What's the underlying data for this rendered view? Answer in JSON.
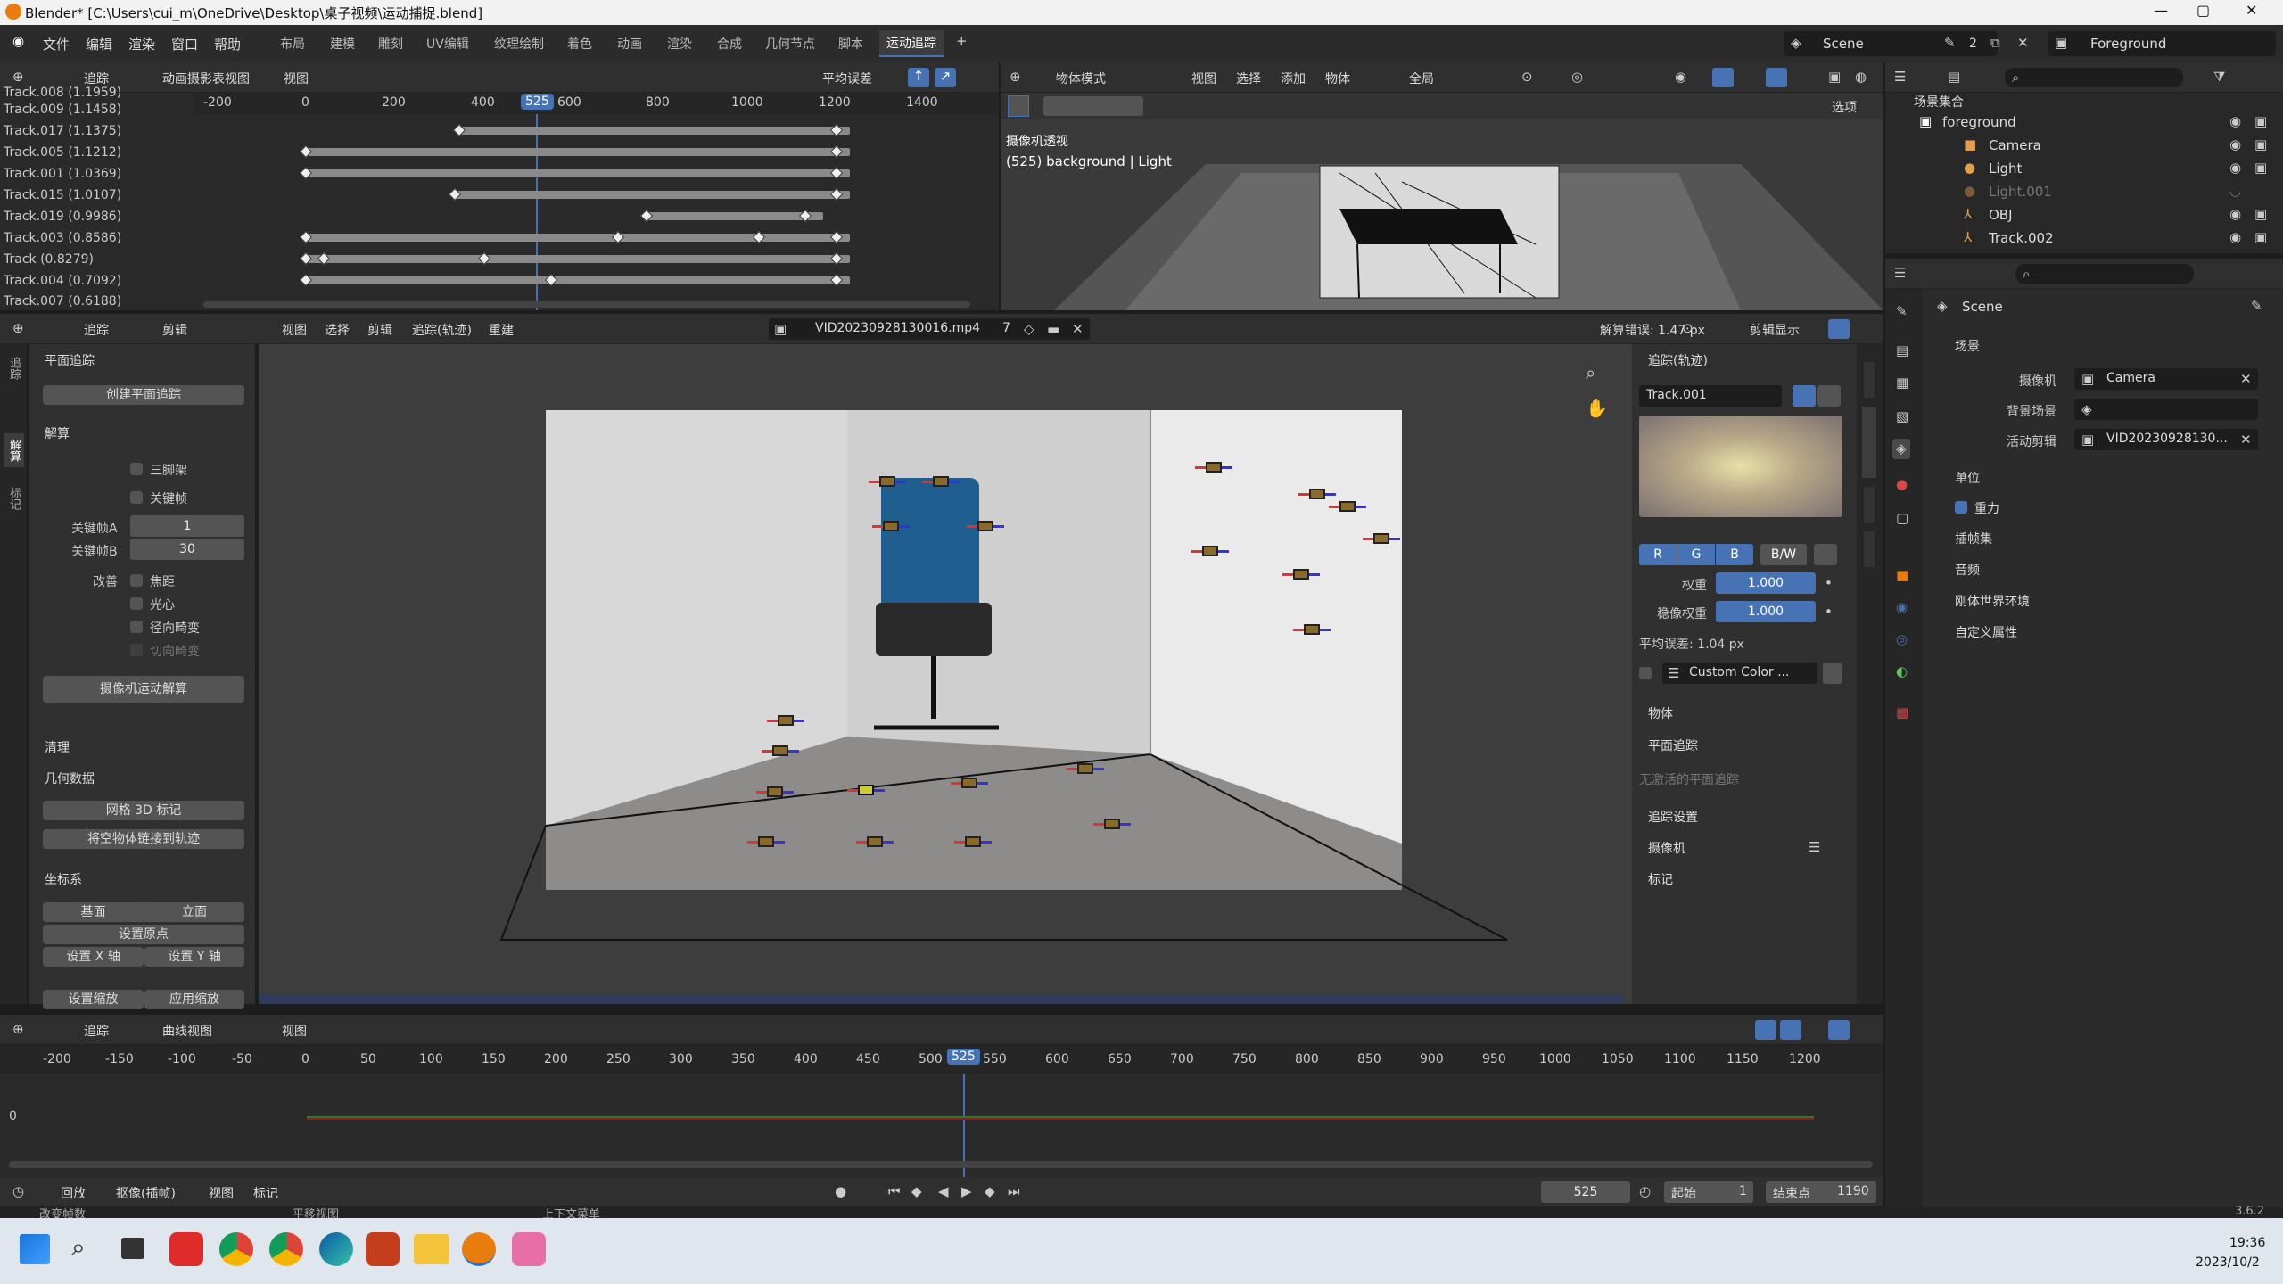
{
  "window": {
    "title": "Blender* [C:\\Users\\cui_m\\OneDrive\\Desktop\\桌子视频\\运动捕捉.blend]"
  },
  "menu": {
    "file": "文件",
    "edit": "编辑",
    "render": "渲染",
    "window": "窗口",
    "help": "帮助"
  },
  "workspaces": [
    "布局",
    "建模",
    "雕刻",
    "UV编辑",
    "纹理绘制",
    "着色",
    "动画",
    "渲染",
    "合成",
    "几何节点",
    "脚本",
    "运动追踪"
  ],
  "topright": {
    "scene": "Scene",
    "scene_count": "2",
    "view_layer": "Foreground"
  },
  "dopesheet": {
    "mode": "追踪",
    "view_mode": "动画摄影表视图",
    "menu_view": "视图",
    "sort": "平均误差",
    "ruler": [
      "-200",
      "0",
      "200",
      "400",
      "600",
      "800",
      "1000",
      "1200",
      "1400"
    ],
    "current_frame": "525",
    "tracks": [
      "Track.008 (1.1959)",
      "Track.009 (1.1458)",
      "Track.017 (1.1375)",
      "Track.005 (1.1212)",
      "Track.001 (1.0369)",
      "Track.015 (1.0107)",
      "Track.019 (0.9986)",
      "Track.003 (0.8586)",
      "Track (0.8279)",
      "Track.004 (0.7092)",
      "Track.007 (0.6188)"
    ]
  },
  "viewport3d": {
    "mode": "物体模式",
    "menus": [
      "视图",
      "选择",
      "添加",
      "物体"
    ],
    "transform": "全局",
    "options": "选项",
    "overlay_title": "摄像机透视",
    "overlay_sub": "(525) background | Light"
  },
  "outliner": {
    "root": "场景集合",
    "items": [
      {
        "name": "foreground"
      },
      {
        "name": "Camera"
      },
      {
        "name": "Light"
      },
      {
        "name": "Light.001"
      },
      {
        "name": "OBJ"
      },
      {
        "name": "Track.002"
      }
    ]
  },
  "properties": {
    "scene": "Scene",
    "section": "场景",
    "camera_label": "摄像机",
    "camera_value": "Camera",
    "bg_label": "背景场景",
    "clip_label": "活动剪辑",
    "clip_value": "VID20230928130...",
    "panels": [
      "单位",
      "重力",
      "插帧集",
      "音频",
      "刚体世界环境",
      "自定义属性"
    ]
  },
  "clip_editor": {
    "mode": "追踪",
    "view": "剪辑",
    "menus": [
      "视图",
      "选择",
      "剪辑",
      "追踪(轨迹)",
      "重建"
    ],
    "clip_name": "VID20230928130016.mp4",
    "users": "7",
    "solve_error": "解算错误: 1.47 px",
    "display": "剪辑显示"
  },
  "toolshelf": {
    "tabs": [
      "追踪",
      "解算",
      "标记"
    ],
    "plane_track": "平面追踪",
    "create_plane": "创建平面追踪",
    "solve": "解算",
    "tripod": "三脚架",
    "keyframe": "关键帧",
    "kfa_label": "关键帧A",
    "kfa": "1",
    "kfb_label": "关键帧B",
    "kfb": "30",
    "refine": "改善",
    "focal": "焦距",
    "optical": "光心",
    "radial": "径向畸变",
    "tangent": "切向畸变",
    "solve_camera": "摄像机运动解算",
    "clean": "清理",
    "geometry": "几何数据",
    "mesh3d": "网格 3D 标记",
    "link_empty": "将空物体链接到轨迹",
    "orientation": "坐标系",
    "floor": "基面",
    "wall": "立面",
    "origin": "设置原点",
    "setx": "设置 X 轴",
    "sety": "设置 Y 轴",
    "setscale": "设置缩放",
    "applyscale": "应用缩放"
  },
  "track_panel": {
    "header": "追踪(轨迹)",
    "name": "Track.001",
    "channels": [
      "R",
      "G",
      "B",
      "B/W"
    ],
    "weight_label": "权重",
    "weight": "1.000",
    "stab_label": "稳像权重",
    "stab": "1.000",
    "avg_error": "平均误差: 1.04 px",
    "custom_color": "Custom Color ...",
    "object": "物体",
    "plane": "平面追踪",
    "no_plane": "无激活的平面追踪",
    "track_settings": "追踪设置",
    "camera": "摄像机",
    "marker": "标记"
  },
  "graph": {
    "mode": "追踪",
    "view": "曲线视图",
    "menu_view": "视图",
    "ruler": [
      "-200",
      "-150",
      "-100",
      "-50",
      "0",
      "50",
      "100",
      "150",
      "200",
      "250",
      "300",
      "350",
      "400",
      "450",
      "500",
      "525",
      "550",
      "600",
      "650",
      "700",
      "750",
      "800",
      "850",
      "900",
      "950",
      "1000",
      "1050",
      "1100",
      "1150",
      "1200"
    ],
    "zero": "0"
  },
  "timeline": {
    "playback": "回放",
    "keying": "抠像(插帧)",
    "view": "视图",
    "marker": "标记",
    "frame": "525",
    "start_label": "起始",
    "start": "1",
    "end_label": "结束点",
    "end": "1190"
  },
  "statusbar": {
    "left1": "改变帧数",
    "left2": "平移视图",
    "left3": "上下文菜单",
    "version": "3.6.2"
  },
  "taskbar": {
    "time": "19:36",
    "date": "2023/10/2"
  },
  "colors": {
    "accent": "#4772b3",
    "bg": "#303030",
    "header": "#2f2f2f"
  }
}
